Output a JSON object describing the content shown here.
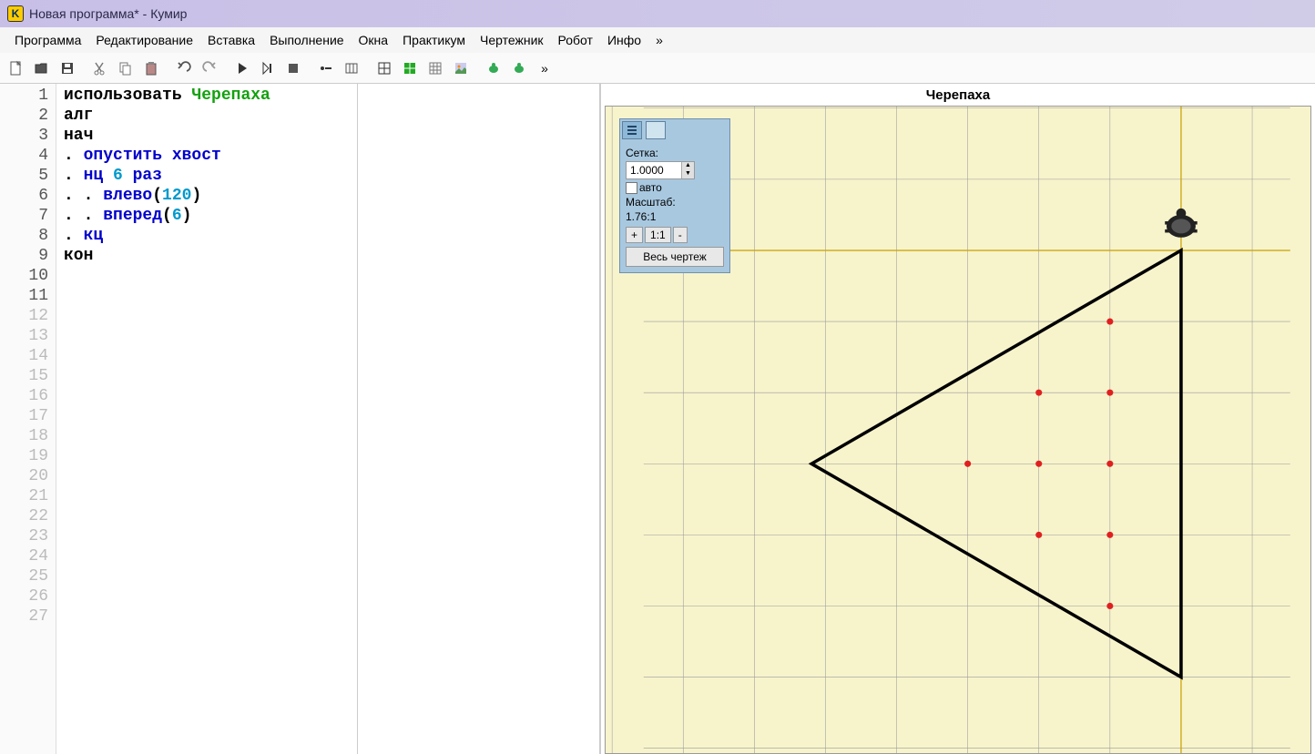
{
  "titlebar": {
    "title": "Новая программа* - Кумир",
    "icon_letter": "K"
  },
  "menubar": {
    "items": [
      "Программа",
      "Редактирование",
      "Вставка",
      "Выполнение",
      "Окна",
      "Практикум",
      "Чертежник",
      "Робот",
      "Инфо",
      "»"
    ]
  },
  "toolbar": {
    "overflow_indicator": "»"
  },
  "editor": {
    "lines": [
      {
        "n": "1",
        "tokens": [
          {
            "t": "использовать ",
            "c": "kw"
          },
          {
            "t": "Черепаха",
            "c": "green"
          }
        ]
      },
      {
        "n": "2",
        "tokens": [
          {
            "t": "алг",
            "c": "kw"
          }
        ]
      },
      {
        "n": "3",
        "tokens": [
          {
            "t": "нач",
            "c": "kw"
          }
        ]
      },
      {
        "n": "4",
        "tokens": [
          {
            "t": ". ",
            "c": "punct"
          },
          {
            "t": "опустить хвост",
            "c": "blue"
          }
        ]
      },
      {
        "n": "5",
        "tokens": [
          {
            "t": ". ",
            "c": "punct"
          },
          {
            "t": "нц ",
            "c": "blue"
          },
          {
            "t": "6",
            "c": "lightblue"
          },
          {
            "t": " раз",
            "c": "blue"
          }
        ]
      },
      {
        "n": "6",
        "tokens": [
          {
            "t": ". . ",
            "c": "punct"
          },
          {
            "t": "влево",
            "c": "blue"
          },
          {
            "t": "(",
            "c": "punct"
          },
          {
            "t": "120",
            "c": "lightblue"
          },
          {
            "t": ")",
            "c": "punct"
          }
        ]
      },
      {
        "n": "7",
        "tokens": [
          {
            "t": ". . ",
            "c": "punct"
          },
          {
            "t": "вперед",
            "c": "blue"
          },
          {
            "t": "(",
            "c": "punct"
          },
          {
            "t": "6",
            "c": "lightblue"
          },
          {
            "t": ")",
            "c": "punct"
          }
        ]
      },
      {
        "n": "8",
        "tokens": [
          {
            "t": ". ",
            "c": "punct"
          },
          {
            "t": "кц",
            "c": "blue"
          }
        ]
      },
      {
        "n": "9",
        "tokens": [
          {
            "t": "кон",
            "c": "kw"
          }
        ]
      },
      {
        "n": "10",
        "tokens": []
      },
      {
        "n": "11",
        "tokens": []
      }
    ],
    "faded_from": 12,
    "faded_to": 27
  },
  "turtle_pane": {
    "title": "Черепаха",
    "panel": {
      "grid_label": "Сетка:",
      "grid_value": "1.0000",
      "auto_label": "авто",
      "scale_label": "Масштаб:",
      "scale_value": "1.76:1",
      "zoom_plus": "+",
      "zoom_reset": "1:1",
      "zoom_minus": "-",
      "fit_label": "Весь чертеж"
    }
  },
  "chart_data": {
    "type": "diagram",
    "description": "Turtle graphics output: equilateral triangle drawn by 6 iterations of turn-left-120, forward-6",
    "grid_step": 1.0,
    "scale": "1.76:1",
    "origin_world": [
      0,
      0
    ],
    "turtle_position": [
      0,
      0
    ],
    "triangle_vertices_world": [
      [
        0,
        0
      ],
      [
        0,
        -6
      ],
      [
        -5.196,
        -3
      ]
    ],
    "red_dots_world": [
      [
        -1,
        -1
      ],
      [
        -1,
        -2
      ],
      [
        -2,
        -2
      ],
      [
        -1,
        -3
      ],
      [
        -2,
        -3
      ],
      [
        -3,
        -3
      ],
      [
        -1,
        -4
      ],
      [
        -2,
        -4
      ],
      [
        -1,
        -5
      ]
    ]
  }
}
